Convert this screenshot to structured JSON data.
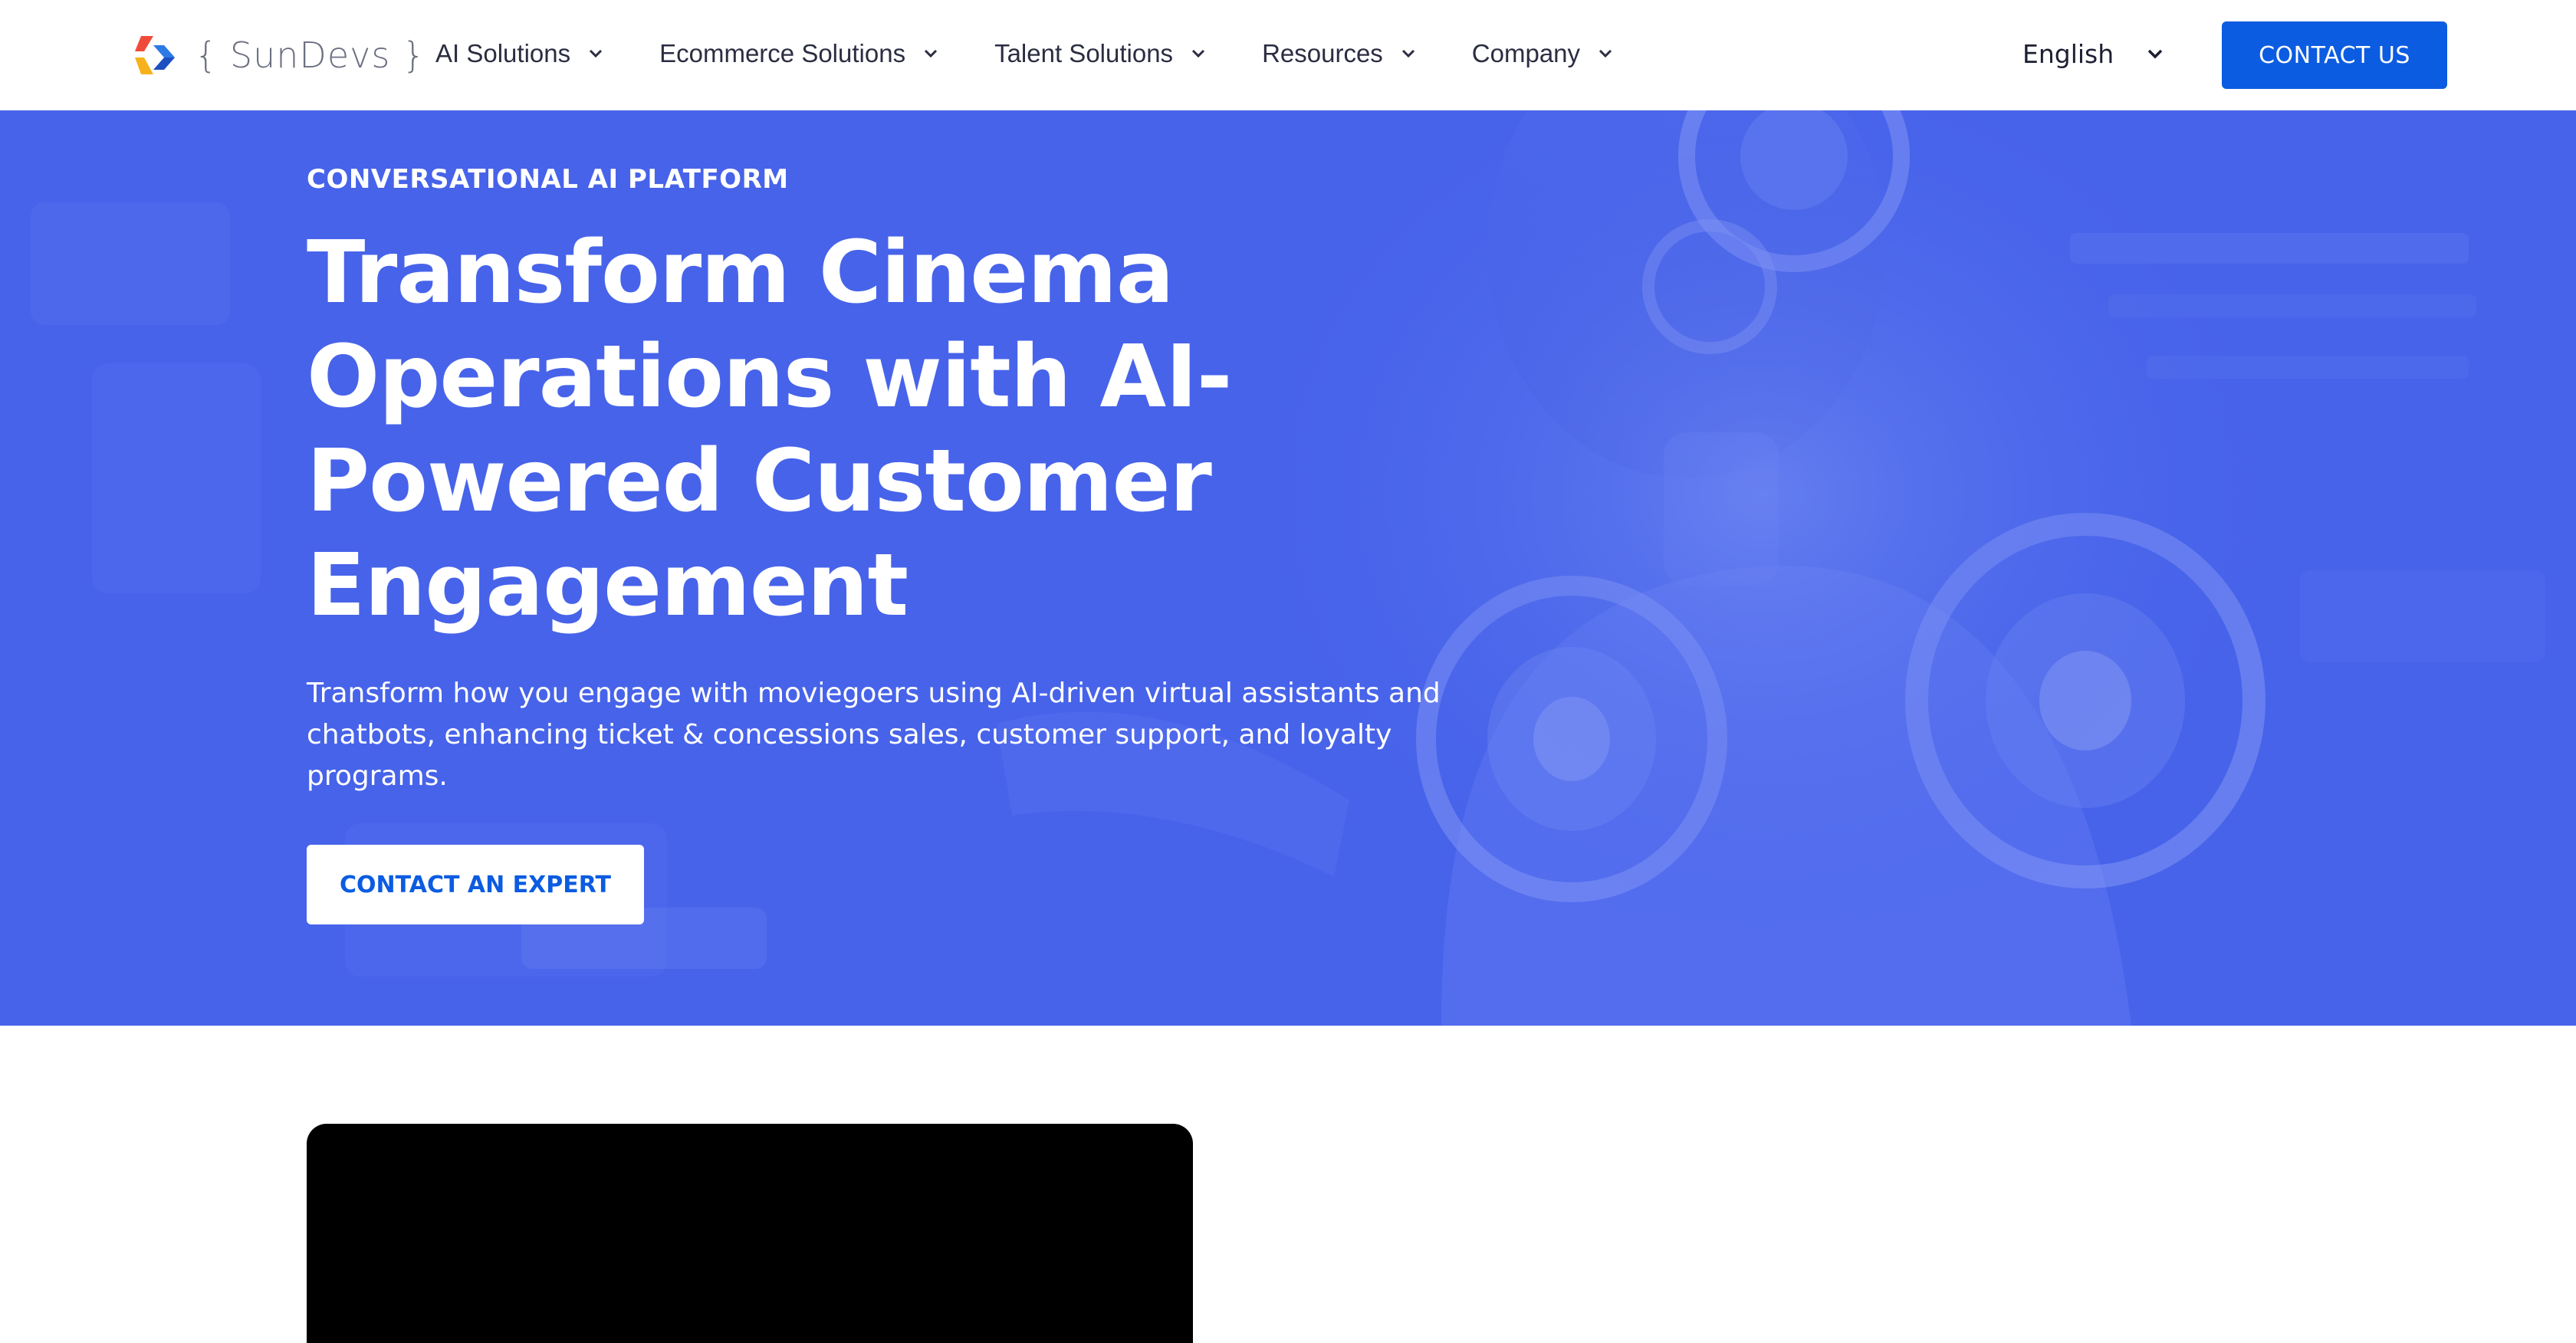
{
  "header": {
    "logo_text": "{ SunDevs }",
    "nav": [
      {
        "label": "AI Solutions"
      },
      {
        "label": "Ecommerce Solutions"
      },
      {
        "label": "Talent Solutions"
      },
      {
        "label": "Resources"
      },
      {
        "label": "Company"
      }
    ],
    "language": "English",
    "contact_label": "CONTACT US"
  },
  "hero": {
    "eyebrow": "CONVERSATIONAL AI PLATFORM",
    "title": "Transform Cinema Operations with AI-Powered Customer Engagement",
    "description": "Transform how you engage with moviegoers using AI-driven virtual assistants and chatbots, enhancing ticket & concessions sales, customer support, and loyalty programs.",
    "cta_label": "CONTACT AN EXPERT"
  },
  "colors": {
    "accent": "#0b5ce0",
    "hero_bg": "#4763ea",
    "text_dark": "#2b2d42"
  },
  "icons": {
    "logo": "sundevs-logo-icon",
    "chevron": "chevron-down-icon"
  }
}
